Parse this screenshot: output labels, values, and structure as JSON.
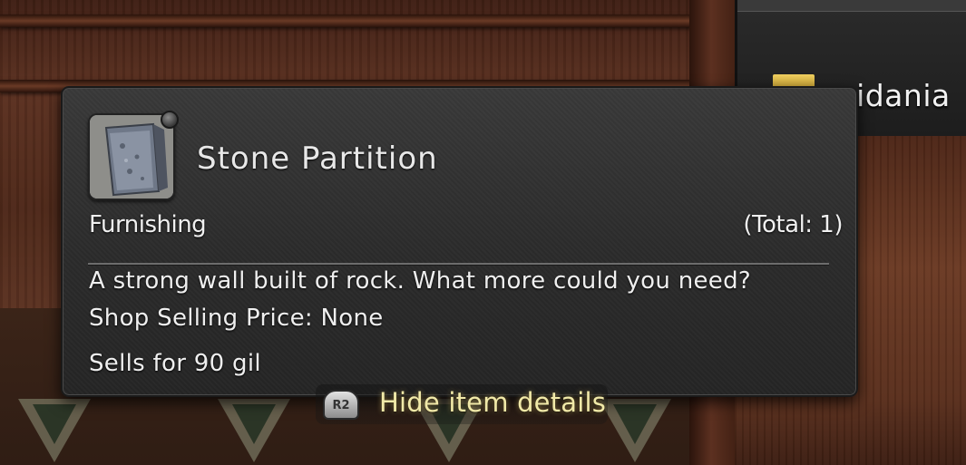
{
  "location": {
    "name": "ridania",
    "icon": "map-marker-icon"
  },
  "tooltip": {
    "item_name": "Stone Partition",
    "item_icon": "stone-partition-icon",
    "category": "Furnishing",
    "total": "(Total: 1)",
    "description": "A strong wall built of rock. What more could you need?",
    "shop_selling_price": "Shop Selling Price: None",
    "sells_for": "Sells for 90 gil"
  },
  "prompt": {
    "button_label": "R2",
    "action_label": "Hide item details",
    "button_icon": "r2-trigger-icon"
  },
  "colors": {
    "tooltip_bg": "#2b2b2b",
    "text": "#efefef",
    "prompt_text": "#f1e9a8"
  }
}
